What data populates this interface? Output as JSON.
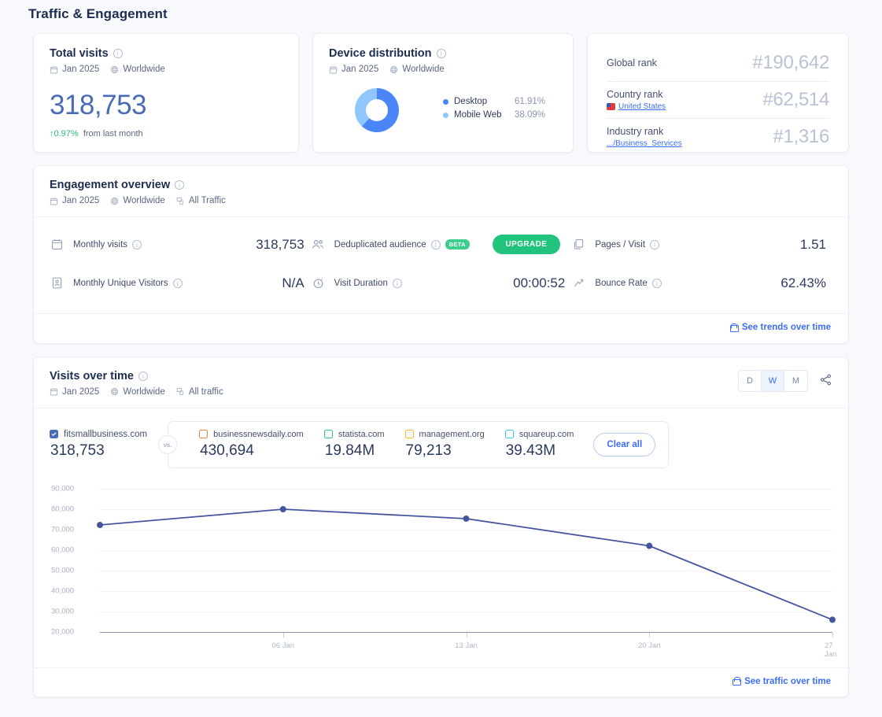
{
  "page": {
    "title": "Traffic & Engagement"
  },
  "total_visits": {
    "title": "Total visits",
    "date": "Jan 2025",
    "geo": "Worldwide",
    "value": "318,753",
    "delta": "0.97%",
    "delta_arrow": "↑",
    "delta_suffix": "from last month",
    "delta_color": "#2eb872"
  },
  "device_distribution": {
    "title": "Device distribution",
    "date": "Jan 2025",
    "geo": "Worldwide",
    "legend": [
      {
        "name": "Desktop",
        "value": "61.91%",
        "pct": 61.91,
        "color": "#4a86f7"
      },
      {
        "name": "Mobile Web",
        "value": "38.09%",
        "pct": 38.09,
        "color": "#8fc6fb"
      }
    ]
  },
  "ranks": [
    {
      "label": "Global rank",
      "sub": "",
      "value": "#190,642"
    },
    {
      "label": "Country rank",
      "sub": "United States",
      "value": "#62,514"
    },
    {
      "label": "Industry rank",
      "sub": ".../Business_Services",
      "value": "#1,316"
    }
  ],
  "engagement": {
    "title": "Engagement overview",
    "date": "Jan 2025",
    "geo": "Worldwide",
    "traffic": "All Traffic",
    "metrics": [
      {
        "icon": "calendar-icon",
        "label": "Monthly visits",
        "value": "318,753"
      },
      {
        "icon": "id-card-icon",
        "label": "Monthly Unique Visitors",
        "value": "N/A"
      },
      {
        "icon": "people-icon",
        "label": "Deduplicated audience",
        "badge": "BETA",
        "button": "UPGRADE"
      },
      {
        "icon": "stopwatch-icon",
        "label": "Visit Duration",
        "value": "00:00:52"
      },
      {
        "icon": "pages-icon",
        "label": "Pages / Visit",
        "value": "1.51"
      },
      {
        "icon": "bounce-icon",
        "label": "Bounce Rate",
        "value": "62.43%"
      }
    ],
    "footer_link": "See trends over time"
  },
  "visits_over_time": {
    "title": "Visits over time",
    "date": "Jan 2025",
    "geo": "Worldwide",
    "traffic": "All traffic",
    "granularity": [
      {
        "label": "D",
        "selected": false
      },
      {
        "label": "W",
        "selected": true
      },
      {
        "label": "M",
        "selected": false
      }
    ],
    "vs_label": "vs.",
    "clear_all": "Clear all",
    "self": {
      "name": "fitsmallbusiness.com",
      "value": "318,753",
      "color": "#4a6bb5"
    },
    "competitors": [
      {
        "name": "businessnewsdaily.com",
        "value": "430,694",
        "color": "#f2802e"
      },
      {
        "name": "statista.com",
        "value": "19.84M",
        "color": "#2ec48a"
      },
      {
        "name": "management.org",
        "value": "79,213",
        "color": "#f5b921"
      },
      {
        "name": "squareup.com",
        "value": "39.43M",
        "color": "#34cfe0"
      }
    ],
    "footer_link": "See traffic over time"
  },
  "chart_data": {
    "type": "line",
    "title": "Visits over time",
    "xlabel": "",
    "ylabel": "",
    "ylim": [
      20000,
      90000
    ],
    "yticks": [
      "90,000",
      "80,000",
      "70,000",
      "60,000",
      "50,000",
      "40,000",
      "30,000",
      "20,000"
    ],
    "ytick_values": [
      90000,
      80000,
      70000,
      60000,
      50000,
      40000,
      30000,
      20000
    ],
    "xticks": [
      "06 Jan",
      "13 Jan",
      "20 Jan",
      "27 Jan"
    ],
    "grid": true,
    "legend_position": "top",
    "series": [
      {
        "name": "fitsmallbusiness.com",
        "color": "#46569e",
        "x": [
          "30 Dec",
          "06 Jan",
          "13 Jan",
          "20 Jan",
          "27 Jan"
        ],
        "values": [
          72300,
          80000,
          75400,
          62100,
          26000
        ]
      }
    ]
  }
}
